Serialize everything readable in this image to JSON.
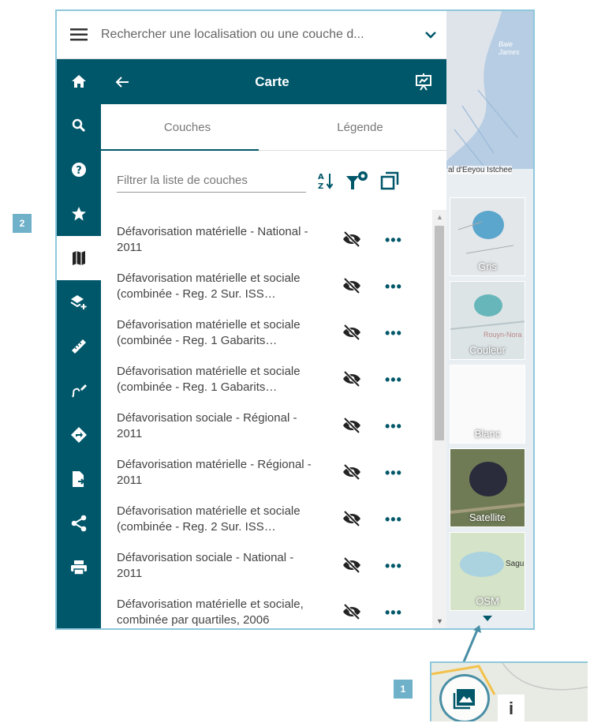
{
  "search": {
    "placeholder": "Rechercher une localisation ou une couche d..."
  },
  "panel": {
    "title": "Carte",
    "tabs": [
      "Couches",
      "Légende"
    ],
    "filter_placeholder": "Filtrer la liste de couches"
  },
  "layers": [
    "Défavorisation matérielle - National - 2011",
    "Défavorisation matérielle et sociale (combinée - Reg. 2 Sur. ISS…",
    "Défavorisation matérielle et sociale (combinée - Reg. 1 Gabarits…",
    "Défavorisation matérielle et sociale (combinée - Reg. 1 Gabarits…",
    "Défavorisation sociale - Régional - 2011",
    "Défavorisation matérielle - Régional - 2011",
    "Défavorisation matérielle et sociale (combinée - Reg. 2 Sur. ISS…",
    "Défavorisation sociale - National - 2011",
    "Défavorisation matérielle et sociale, combinée par quartiles, 2006"
  ],
  "more_label": "•••",
  "basemaps": [
    "Gris",
    "Couleur",
    "Blanc",
    "Satellite",
    "OSM"
  ],
  "map_labels": {
    "top": "Baie James",
    "mid": "al d'Eeyou Istchee",
    "rouyn": "Rouyn-Nora",
    "sag": "Sagu"
  },
  "badges": {
    "one": "1",
    "two": "2"
  },
  "inset_info": "i",
  "sidebar_icons": [
    "home-icon",
    "search-icon",
    "help-icon",
    "star-icon",
    "map-icon",
    "add-layer-icon",
    "ruler-icon",
    "draw-icon",
    "directions-icon",
    "export-icon",
    "share-icon",
    "print-icon"
  ],
  "colors": {
    "primary": "#00576a",
    "accent": "#8ec8dc",
    "badge": "#6fb1c9"
  }
}
